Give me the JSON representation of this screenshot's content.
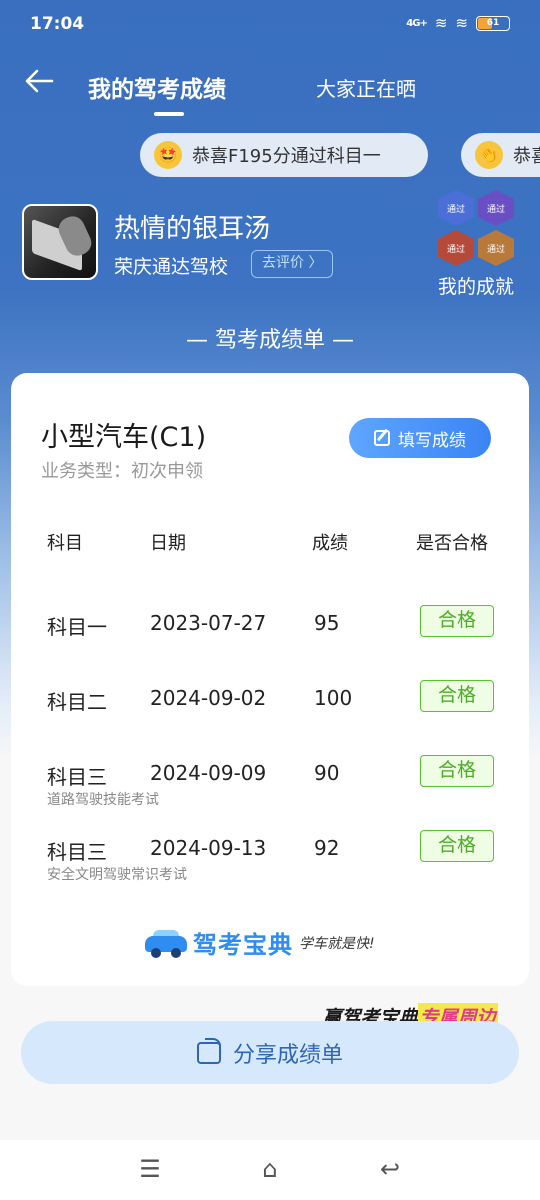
{
  "status": {
    "time": "17:04",
    "network": "4G+",
    "battery": "61"
  },
  "nav": {
    "back_icon": "arrow-left-icon",
    "tab_active": "我的驾考成绩",
    "tab_other": "大家正在晒"
  },
  "ticker": [
    {
      "emoji": "🤩",
      "text": "恭喜F195分通过科目一"
    },
    {
      "emoji": "👏",
      "text": "恭喜"
    }
  ],
  "user": {
    "name": "热情的银耳汤",
    "school": "荣庆通达驾校",
    "rate_label": "去评价 〉"
  },
  "achievements": {
    "label": "我的成就",
    "badges": [
      "通过",
      "通过",
      "通过",
      "通过"
    ],
    "badge_colors": [
      "#4b6fd6",
      "#6a4fc4",
      "#b54a3a",
      "#b87a3a"
    ]
  },
  "section_title": "— 驾考成绩单 —",
  "card": {
    "vehicle_type": "小型汽车(C1)",
    "business_type": "业务类型：初次申领",
    "fill_button": "填写成绩",
    "headers": [
      "科目",
      "日期",
      "成绩",
      "是否合格"
    ],
    "rows": [
      {
        "subject": "科目一",
        "date": "2023-07-27",
        "score": "95",
        "result": "合格",
        "note": ""
      },
      {
        "subject": "科目二",
        "date": "2024-09-02",
        "score": "100",
        "result": "合格",
        "note": ""
      },
      {
        "subject": "科目三",
        "date": "2024-09-09",
        "score": "90",
        "result": "合格",
        "note": "道路驾驶技能考试"
      },
      {
        "subject": "科目三",
        "date": "2024-09-13",
        "score": "92",
        "result": "合格",
        "note": "安全文明驾驶常识考试"
      }
    ],
    "brand_name": "驾考宝典",
    "brand_slogan": "学车就是快!"
  },
  "promo": {
    "part1": "赢驾考宝典",
    "part2": "专属周边"
  },
  "share_button": "分享成绩单",
  "navbar": {
    "menu_icon": "☰",
    "home_icon": "⌂",
    "back_icon": "↩"
  },
  "colors": {
    "primary": "#3a6fc0",
    "accent": "#3b84f5",
    "pass": "#4dac26"
  }
}
